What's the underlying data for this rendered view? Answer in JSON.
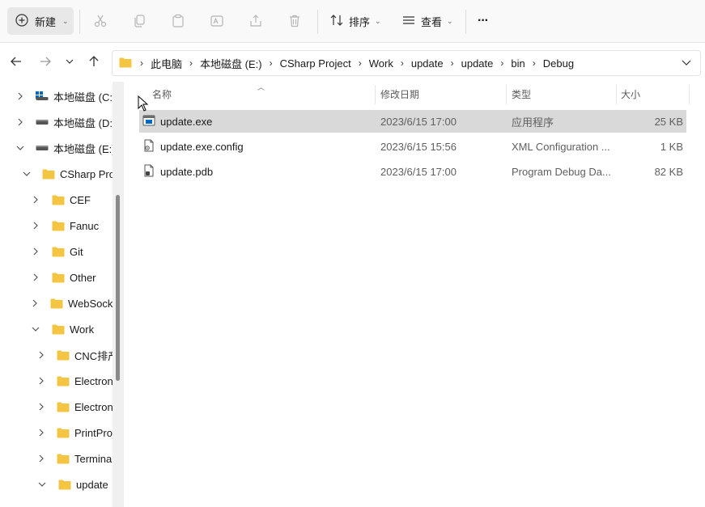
{
  "toolbar": {
    "new_label": "新建",
    "sort_label": "排序",
    "view_label": "查看",
    "more_label": "···"
  },
  "address": {
    "crumbs": [
      "此电脑",
      "本地磁盘 (E:)",
      "CSharp Project",
      "Work",
      "update",
      "update",
      "bin",
      "Debug"
    ]
  },
  "sidebar": {
    "items": [
      {
        "label": "本地磁盘 (C:)",
        "icon": "drive-c-icon",
        "expanded": false
      },
      {
        "label": "本地磁盘 (D:)",
        "icon": "drive-icon",
        "expanded": false
      },
      {
        "label": "本地磁盘 (E:)",
        "icon": "drive-icon",
        "expanded": true
      },
      {
        "label": "CSharp Proje",
        "icon": "folder-icon",
        "expanded": true
      },
      {
        "label": "CEF",
        "icon": "folder-icon",
        "expanded": false
      },
      {
        "label": "Fanuc",
        "icon": "folder-icon",
        "expanded": false
      },
      {
        "label": "Git",
        "icon": "folder-icon",
        "expanded": false
      },
      {
        "label": "Other",
        "icon": "folder-icon",
        "expanded": false
      },
      {
        "label": "WebSocke",
        "icon": "folder-icon",
        "expanded": false
      },
      {
        "label": "Work",
        "icon": "folder-icon",
        "expanded": true
      },
      {
        "label": "CNC排产",
        "icon": "folder-icon",
        "expanded": false
      },
      {
        "label": "Electronic",
        "icon": "folder-icon",
        "expanded": false
      },
      {
        "label": "Electronic",
        "icon": "folder-icon",
        "expanded": false
      },
      {
        "label": "PrintProje",
        "icon": "folder-icon",
        "expanded": false
      },
      {
        "label": "Terminal",
        "icon": "folder-icon",
        "expanded": false
      },
      {
        "label": "update",
        "icon": "folder-icon",
        "expanded": true
      }
    ]
  },
  "list": {
    "columns": {
      "name": "名称",
      "date": "修改日期",
      "type": "类型",
      "size": "大小"
    },
    "rows": [
      {
        "name": "update.exe",
        "date": "2023/6/15 17:00",
        "type": "应用程序",
        "size": "25 KB",
        "icon": "exe-icon",
        "selected": true
      },
      {
        "name": "update.exe.config",
        "date": "2023/6/15 15:56",
        "type": "XML Configuration ...",
        "size": "1 KB",
        "icon": "config-file-icon",
        "selected": false
      },
      {
        "name": "update.pdb",
        "date": "2023/6/15 17:00",
        "type": "Program Debug Da...",
        "size": "82 KB",
        "icon": "pdb-file-icon",
        "selected": false
      }
    ]
  },
  "colors": {
    "folder": "#f4c542",
    "selected_row": "#d9d9d9",
    "accent": "#0067c0"
  }
}
